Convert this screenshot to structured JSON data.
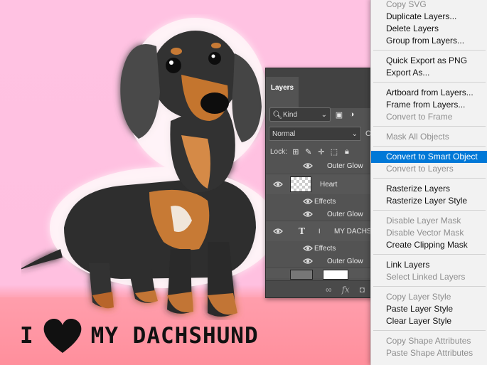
{
  "artwork": {
    "tagline_left": "I",
    "tagline_right": "MY DACHSHUND"
  },
  "layers_panel": {
    "tab_label": "Layers",
    "filter_kind": "Kind",
    "blend_mode": "Normal",
    "opacity_label": "O",
    "lock_label": "Lock:",
    "rows": [
      {
        "type": "effect-item",
        "label": "Outer Glow"
      },
      {
        "type": "layer",
        "label": "Heart"
      },
      {
        "type": "effects-header",
        "label": "Effects"
      },
      {
        "type": "effect-item",
        "label": "Outer Glow"
      },
      {
        "type": "text-layer",
        "label": "MY DACHS"
      },
      {
        "type": "effects-header",
        "label": "Effects"
      },
      {
        "type": "effect-item",
        "label": "Outer Glow"
      }
    ],
    "footer_fx": "fx"
  },
  "context_menu": {
    "items": [
      {
        "label": "Copy SVG",
        "disabled": true
      },
      {
        "label": "Duplicate Layers...",
        "disabled": false
      },
      {
        "label": "Delete Layers",
        "disabled": false
      },
      {
        "label": "Group from Layers...",
        "disabled": false
      },
      {
        "label": "Quick Export as PNG",
        "disabled": false
      },
      {
        "label": "Export As...",
        "disabled": false
      },
      {
        "label": "Artboard from Layers...",
        "disabled": false
      },
      {
        "label": "Frame from Layers...",
        "disabled": false
      },
      {
        "label": "Convert to Frame",
        "disabled": true
      },
      {
        "label": "Mask All Objects",
        "disabled": true
      },
      {
        "label": "Convert to Smart Object",
        "disabled": false,
        "highlighted": true
      },
      {
        "label": "Convert to Layers",
        "disabled": true
      },
      {
        "label": "Rasterize Layers",
        "disabled": false
      },
      {
        "label": "Rasterize Layer Style",
        "disabled": false
      },
      {
        "label": "Disable Layer Mask",
        "disabled": true
      },
      {
        "label": "Disable Vector Mask",
        "disabled": true
      },
      {
        "label": "Create Clipping Mask",
        "disabled": false
      },
      {
        "label": "Link Layers",
        "disabled": false
      },
      {
        "label": "Select Linked Layers",
        "disabled": true
      },
      {
        "label": "Copy Layer Style",
        "disabled": true
      },
      {
        "label": "Paste Layer Style",
        "disabled": false
      },
      {
        "label": "Clear Layer Style",
        "disabled": false
      },
      {
        "label": "Copy Shape Attributes",
        "disabled": true
      },
      {
        "label": "Paste Shape Attributes",
        "disabled": true
      }
    ]
  },
  "colors": {
    "canvas_pink": "#ffc2e2",
    "floor_pink": "#ff8f9f",
    "panel_bg": "#535353",
    "menu_bg": "#f2f2f2",
    "menu_highlight": "#0078d7"
  }
}
